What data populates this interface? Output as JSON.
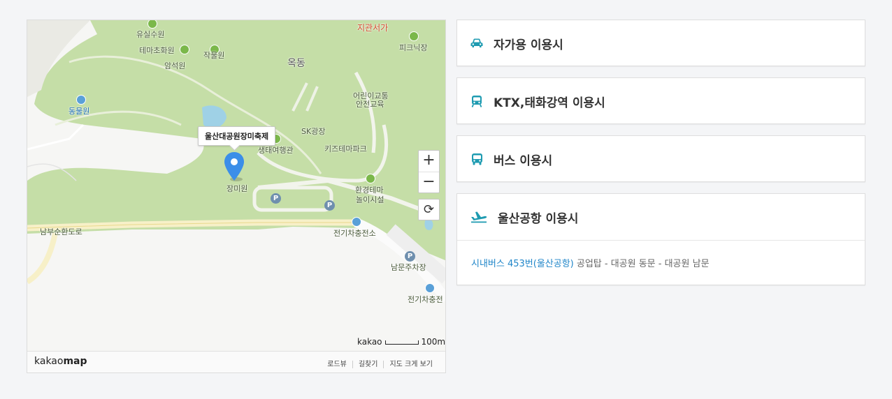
{
  "map": {
    "tooltip": "울산대공원장미축제",
    "labels": {
      "yusilsuwon": "유실수원",
      "temachohwawon": "테마초화원",
      "jakmulwon": "작물원",
      "amseokwon": "암석원",
      "okdong": "옥동",
      "jigwanseoga": "지관서가",
      "piknikjang": "피크닉장",
      "dongmulwon": "동물원",
      "eorinigyotong": "어린이교통",
      "anjeonhakseup": "안전교육",
      "skgwangjang": "SK광장",
      "saengtaeyeohaenggwan": "생태여행관",
      "kidstema": "키즈테마파크",
      "jangmiwon": "장미원",
      "hwangyeongtema": "환경테마",
      "noli": "놀이시설",
      "nambusunhwando": "남부순환도로",
      "jeongicharging1": "전기차충전소",
      "nammunparking": "남문주차장",
      "jeongicharging2": "전기차충전",
      "partial_top": "울산대공원",
      "partial_jang": "장미원",
      "parking": "P"
    },
    "controls": {
      "zoom_in": "+",
      "zoom_out": "−",
      "refresh": "⟳"
    },
    "scale": {
      "brand": "kakao",
      "distance": "100m"
    },
    "footer": {
      "logo_light": "kakao",
      "logo_bold": "map",
      "links": [
        "로드뷰",
        "길찾기",
        "지도 크게 보기"
      ]
    }
  },
  "panels": [
    {
      "icon": "car-icon",
      "title": "자가용 이용시"
    },
    {
      "icon": "train-icon",
      "title": "KTX,태화강역 이용시"
    },
    {
      "icon": "bus-icon",
      "title": "버스 이용시"
    },
    {
      "icon": "airplane-icon",
      "title": "울산공항 이용시",
      "body": {
        "link_text": "시내버스 453번(울산공항)",
        "route": " 공업탑 - 대공원 동문 - 대공원 남문"
      }
    }
  ],
  "colors": {
    "accent": "#1e9bb1",
    "link": "#2086c9",
    "map_green": "#c5dea7",
    "marker": "#3b8ee8"
  }
}
